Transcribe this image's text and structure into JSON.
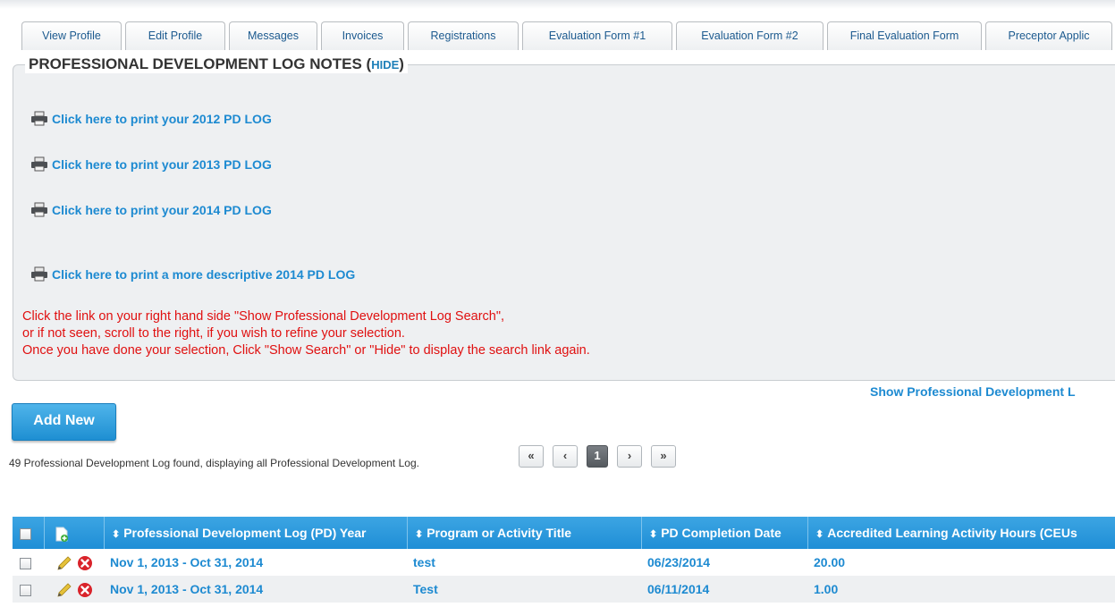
{
  "tabs": [
    {
      "label": "View Profile"
    },
    {
      "label": "Edit Profile"
    },
    {
      "label": "Messages"
    },
    {
      "label": "Invoices"
    },
    {
      "label": "Registrations"
    },
    {
      "label": "Evaluation Form #1"
    },
    {
      "label": "Evaluation Form #2"
    },
    {
      "label": "Final Evaluation Form"
    },
    {
      "label": "Preceptor Applic"
    }
  ],
  "panel": {
    "title": "PROFESSIONAL DEVELOPMENT LOG NOTES",
    "paren_open": "(",
    "hide_label": "HIDE",
    "paren_close": ")"
  },
  "print_links": [
    {
      "label": "Click here to print your 2012 PD LOG",
      "icon": "printer-icon"
    },
    {
      "label": "Click here to print your 2013 PD LOG",
      "icon": "printer-icon"
    },
    {
      "label": "Click here to print your 2014 PD LOG",
      "icon": "printer-icon"
    },
    {
      "label": "Click here to print a more descriptive 2014 PD LOG",
      "icon": "printer-icon"
    }
  ],
  "notice": {
    "line1": "Click the link on your right hand side  \"Show Professional Development Log Search\",",
    "line2": "or if not seen, scroll to the right,  if you wish to refine your selection.",
    "line3": "Once you have done your selection, Click \"Show Search\" or \"Hide\" to display  the search link again.",
    "color": "#e01010"
  },
  "show_search_link": "Show Professional Development L",
  "add_button": "Add New",
  "found_text": "49 Professional Development Log found, displaying all Professional Development Log.",
  "pager": {
    "first": "«",
    "prev": "‹",
    "current": "1",
    "next": "›",
    "last": "»"
  },
  "table": {
    "columns": [
      {
        "label": ""
      },
      {
        "label": "",
        "icon": "add-document-icon"
      },
      {
        "label": "Professional Development Log (PD) Year"
      },
      {
        "label": "Program or Activity Title"
      },
      {
        "label": "PD Completion Date"
      },
      {
        "label": "Accredited Learning Activity Hours (CEUs"
      }
    ],
    "rows": [
      {
        "year": "Nov 1, 2013 - Oct 31, 2014",
        "title": "test",
        "date": "06/23/2014",
        "hours": "20.00"
      },
      {
        "year": "Nov 1, 2013 - Oct 31, 2014",
        "title": "Test",
        "date": "06/11/2014",
        "hours": "1.00"
      }
    ]
  },
  "colors": {
    "accent": "#1d8ad1",
    "header_bg": "#2a98dc",
    "panel_bg": "#eef0f2"
  }
}
